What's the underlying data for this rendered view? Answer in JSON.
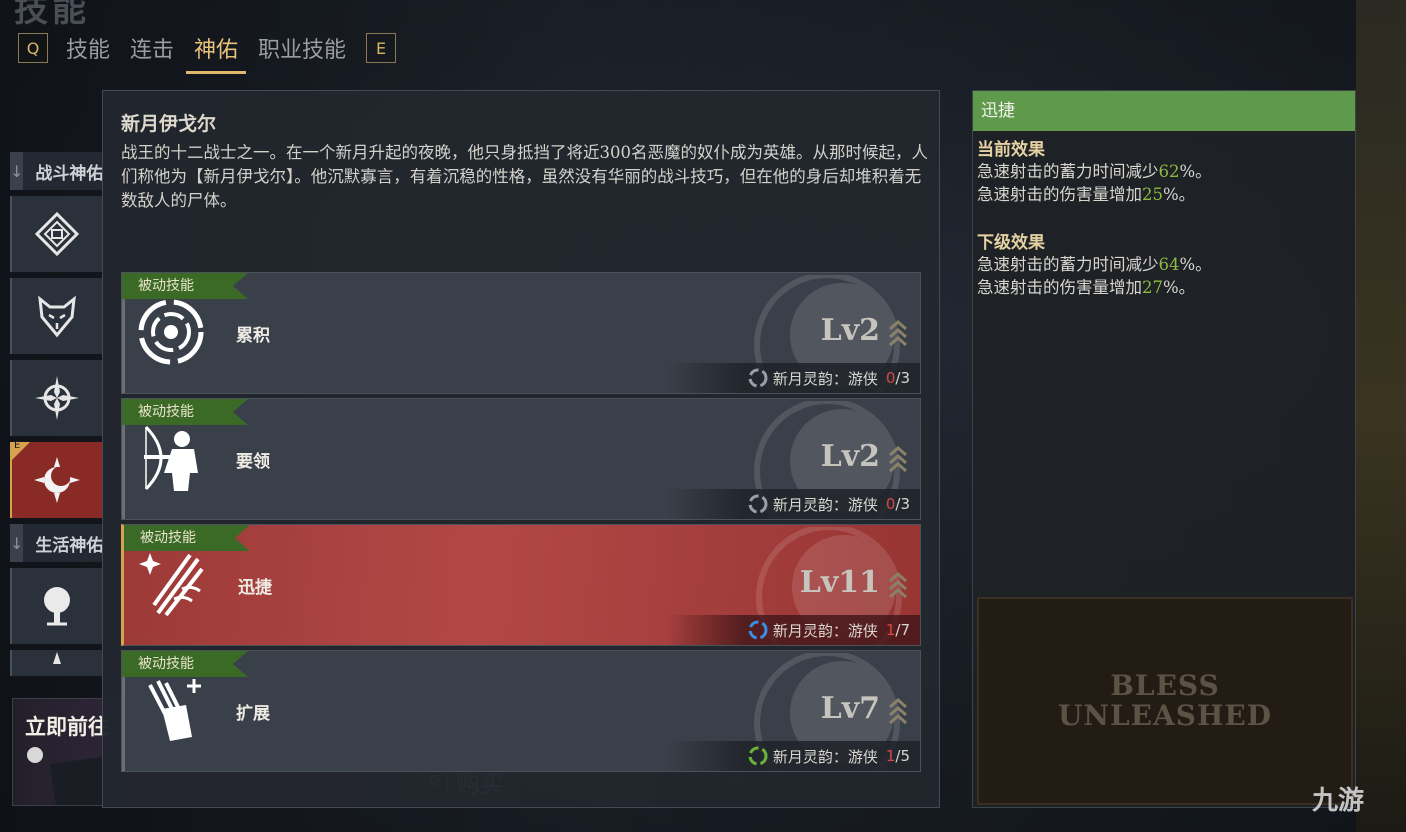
{
  "header": {
    "ghost_title": "技能"
  },
  "tabs": {
    "left_key": "Q",
    "right_key": "E",
    "items": [
      "技能",
      "连击",
      "神佑",
      "职业技能"
    ],
    "active": "神佑"
  },
  "sidebar": {
    "section_combat": "战斗神佑",
    "section_life": "生活神佑",
    "active_badge": "E"
  },
  "promo": {
    "title": "立即前往",
    "buy_key": "G",
    "buy_label": "购买"
  },
  "panel": {
    "title": "新月伊戈尔",
    "description": "战王的十二战士之一。在一个新月升起的夜晚，他只身抵挡了将近300名恶魔的奴仆成为英雄。从那时候起，人们称他为【新月伊戈尔】。他沉默寡言，有着沉稳的性格，虽然没有华丽的战斗技巧，但在他的身后却堆积着无数敌人的尸体。"
  },
  "skills": [
    {
      "tag": "被动技能",
      "name": "累积",
      "level": "Lv2",
      "resonance_label": "新月灵韵：游侠",
      "current": "0",
      "max": "/3",
      "icon": "spiral-eye-icon"
    },
    {
      "tag": "被动技能",
      "name": "要领",
      "level": "Lv2",
      "resonance_label": "新月灵韵：游侠",
      "current": "0",
      "max": "/3",
      "icon": "archer-icon"
    },
    {
      "tag": "被动技能",
      "name": "迅捷",
      "level": "Lv11",
      "resonance_label": "新月灵韵：游侠",
      "current": "1",
      "max": "/7",
      "icon": "swift-arrows-icon",
      "selected": true
    },
    {
      "tag": "被动技能",
      "name": "扩展",
      "level": "Lv7",
      "resonance_label": "新月灵韵：游侠",
      "current": "1",
      "max": "/5",
      "icon": "quiver-plus-icon"
    }
  ],
  "detail": {
    "title": "迅捷",
    "current_header": "当前效果",
    "current": [
      {
        "pre": "急速射击的蓄力时间减少",
        "val": "62",
        "post": "%。"
      },
      {
        "pre": "急速射击的伤害量增加",
        "val": "25",
        "post": "%。"
      }
    ],
    "next_header": "下级效果",
    "next": [
      {
        "pre": "急速射击的蓄力时间减少",
        "val": "64",
        "post": "%。"
      },
      {
        "pre": "急速射击的伤害量增加",
        "val": "27",
        "post": "%。"
      }
    ]
  },
  "logo": {
    "line1": "BLESS",
    "line2": "UNLEASHED"
  },
  "watermark": "九游",
  "colors": {
    "accent_gold": "#e0b86a",
    "tag_green": "#3b6a26",
    "selected_red": "#b24846",
    "value_green": "#8cbb3f",
    "count_red": "#d54848"
  }
}
